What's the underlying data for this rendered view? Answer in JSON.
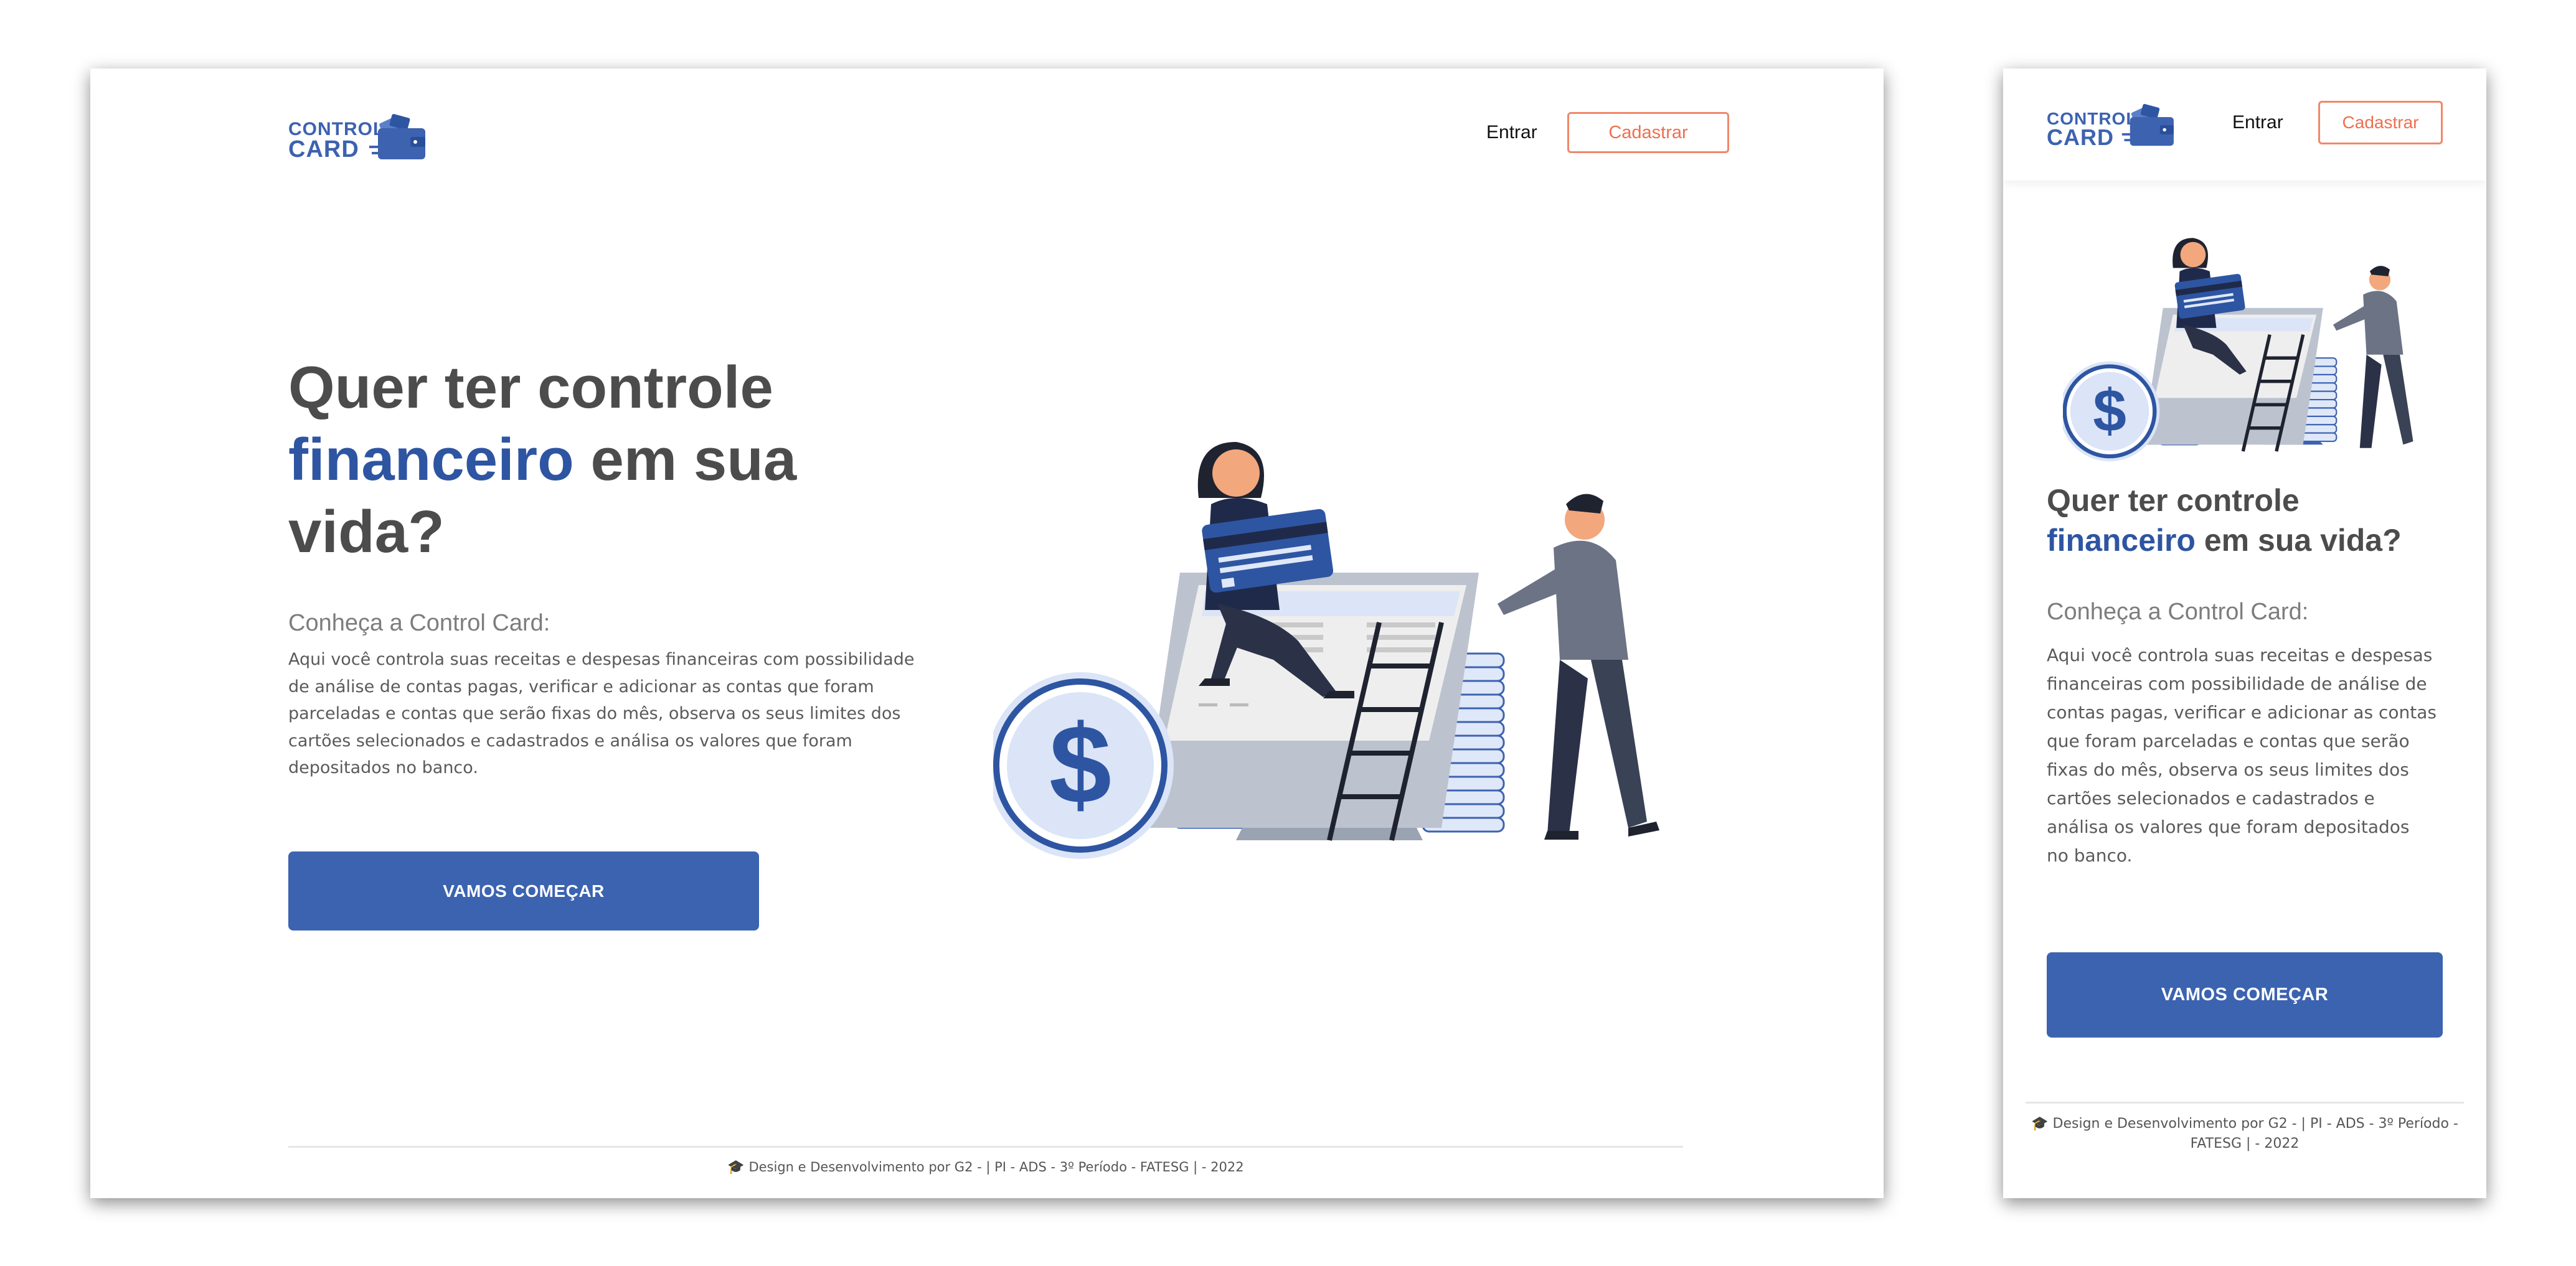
{
  "brand": {
    "line1": "CONTROL",
    "line2": "CARD"
  },
  "nav": {
    "login": "Entrar",
    "signup": "Cadastrar"
  },
  "hero": {
    "headline_part1": "Quer ter controle",
    "headline_accent": "financeiro",
    "headline_part2": "em sua",
    "headline_part3": "vida?",
    "headline_part2_mobile": "em sua vida?",
    "subtitle": "Conheça a Control Card:",
    "desktop_lines": [
      "Aqui você controla suas receitas e despesas financeiras com possibilidade",
      "de análise de contas pagas, verificar e adicionar as contas que foram",
      "parceladas e contas que serão fixas do mês, observa os seus limites dos",
      "cartões selecionados e cadastrados e análisa os valores que foram",
      "depositados no banco."
    ],
    "mobile_lines": [
      "Aqui você controla suas receitas e despesas",
      "financeiras com possibilidade de análise de",
      "contas pagas, verificar e adicionar as contas",
      "que foram parceladas e contas que serão",
      "fixas do mês, observa os seus limites dos",
      "cartões selecionados e cadastrados e",
      "análisa os valores que foram depositados",
      "no banco."
    ],
    "cta": "VAMOS COMEÇAR"
  },
  "footer": {
    "text": "Design e Desenvolvimento por G2 - | PI - ADS - 3º Período - FATESG | - 2022",
    "mobile_line1": "Design e Desenvolvimento por G2 - | PI - ADS - 3º Período -",
    "mobile_line2": "FATESG | - 2022",
    "icon": "graduation-cap-icon"
  },
  "colors": {
    "brand_blue": "#3b63b0",
    "accent_coral": "#ef6f4f",
    "text_dark": "#4c4c4c"
  }
}
